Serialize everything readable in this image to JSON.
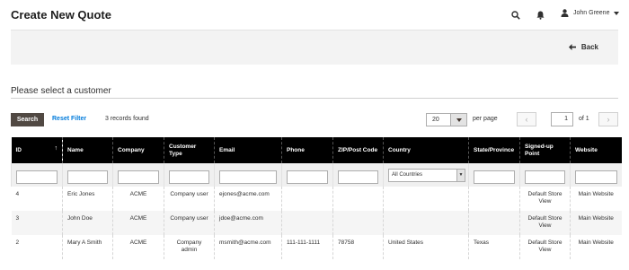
{
  "header": {
    "title": "Create New Quote",
    "user_name": "John Greene"
  },
  "actions": {
    "back_label": "Back"
  },
  "section": {
    "title": "Please select a customer"
  },
  "toolbar": {
    "search_label": "Search",
    "reset_label": "Reset Filter",
    "records_found": "3 records found",
    "per_page_value": "20",
    "per_page_label": "per page",
    "page_current": "1",
    "page_of": "of 1"
  },
  "table": {
    "columns": [
      "ID",
      "Name",
      "Company",
      "Customer Type",
      "Email",
      "Phone",
      "ZIP/Post Code",
      "Country",
      "State/Province",
      "Signed-up Point",
      "Website"
    ],
    "country_filter": "All Countries",
    "rows": [
      {
        "id": "4",
        "name": "Eric Jones",
        "company": "ACME",
        "type": "Company user",
        "email": "ejones@acme.com",
        "phone": "",
        "zip": "",
        "country": "",
        "state": "",
        "signup": "Default Store View",
        "website": "Main Website"
      },
      {
        "id": "3",
        "name": "John Doe",
        "company": "ACME",
        "type": "Company user",
        "email": "jdoe@acme.com",
        "phone": "",
        "zip": "",
        "country": "",
        "state": "",
        "signup": "Default Store View",
        "website": "Main Website"
      },
      {
        "id": "2",
        "name": "Mary A Smith",
        "company": "ACME",
        "type": "Company admin",
        "email": "msmith@acme.com",
        "phone": "111-111-1111",
        "zip": "78758",
        "country": "United States",
        "state": "Texas",
        "signup": "Default Store View",
        "website": "Main Website"
      }
    ]
  },
  "icons": {
    "sort": "sort-ascending-arrow-icon"
  },
  "colors": {
    "header_bg": "#000000",
    "search_btn": "#514943",
    "link": "#007bdb"
  }
}
